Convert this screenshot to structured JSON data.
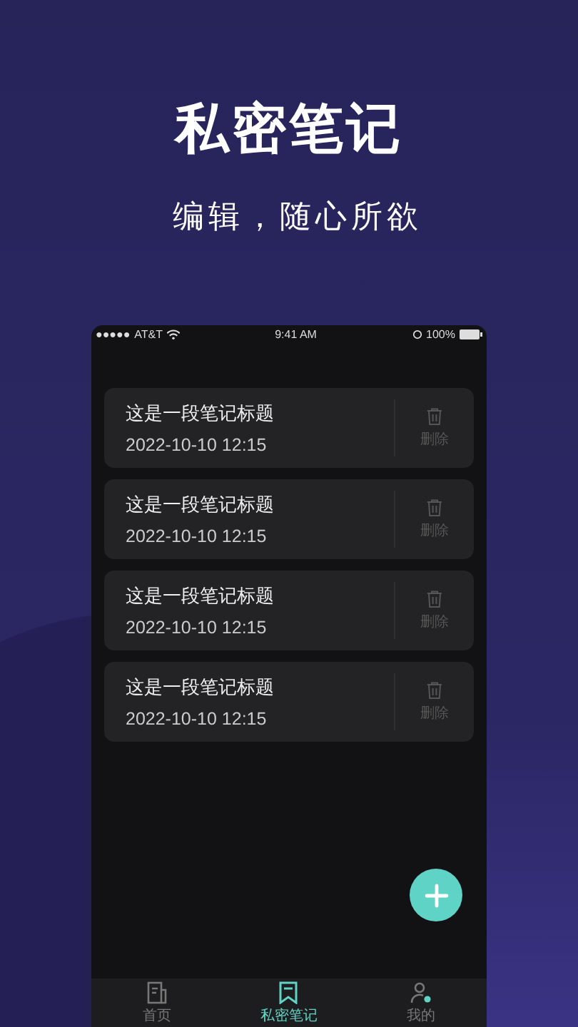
{
  "headline": "私密笔记",
  "subheadline": "编辑，随心所欲",
  "status_bar": {
    "signal": "●●●●●",
    "carrier": "AT&T",
    "time": "9:41 AM",
    "battery": "100%"
  },
  "notes": [
    {
      "title": "这是一段笔记标题",
      "time": "2022-10-10  12:15",
      "delete_label": "删除"
    },
    {
      "title": "这是一段笔记标题",
      "time": "2022-10-10  12:15",
      "delete_label": "删除"
    },
    {
      "title": "这是一段笔记标题",
      "time": "2022-10-10  12:15",
      "delete_label": "删除"
    },
    {
      "title": "这是一段笔记标题",
      "time": "2022-10-10  12:15",
      "delete_label": "删除"
    }
  ],
  "tabs": [
    {
      "label": "首页",
      "kind": "home",
      "selected": false
    },
    {
      "label": "私密笔记",
      "kind": "notes",
      "selected": true
    },
    {
      "label": "我的",
      "kind": "profile",
      "selected": false
    }
  ]
}
